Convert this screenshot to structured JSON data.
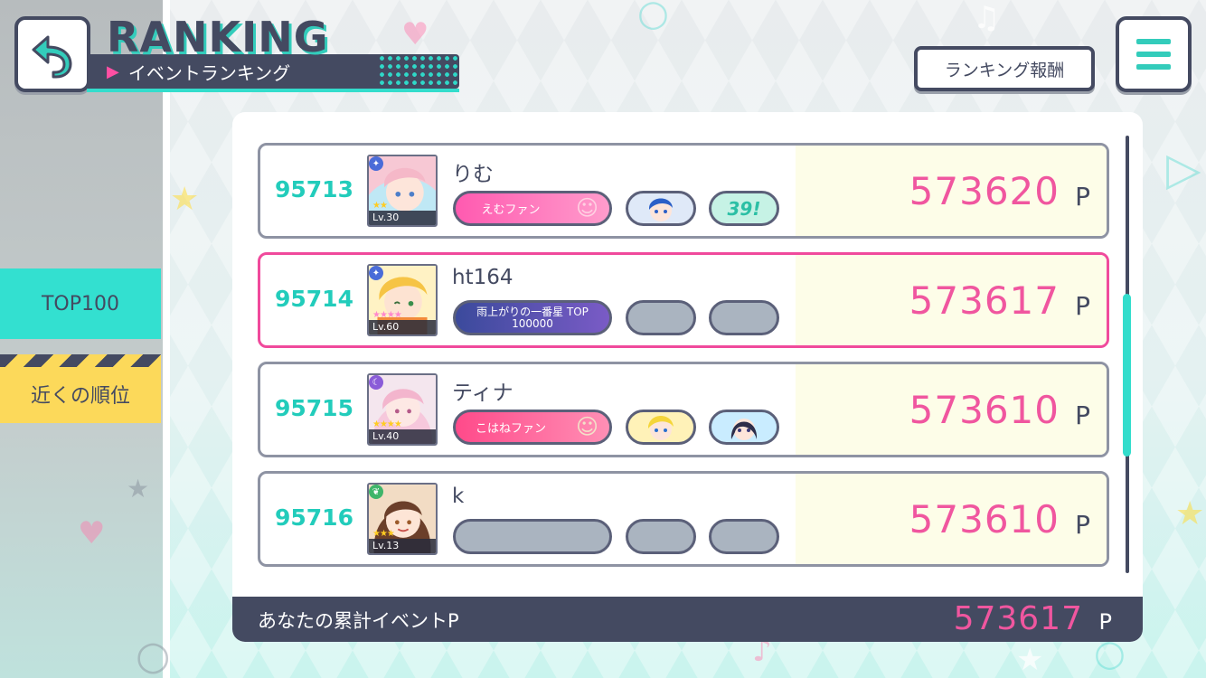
{
  "header": {
    "title": "RANKING",
    "subtitle": "イベントランキング",
    "reward_button": "ランキング報酬"
  },
  "tabs": [
    {
      "label": "TOP100",
      "active": true
    },
    {
      "label": "近くの順位",
      "active": false
    }
  ],
  "rows": [
    {
      "rank": "95713",
      "name": "りむ",
      "level": "Lv.30",
      "score": "573620",
      "unit": "P",
      "highlighted": false,
      "badges": {
        "title": "えむファン",
        "small1": "character-icon",
        "small2": "39!"
      }
    },
    {
      "rank": "95714",
      "name": "ht164",
      "level": "Lv.60",
      "score": "573617",
      "unit": "P",
      "highlighted": true,
      "badges": {
        "title": "雨上がりの一番星 TOP 100000",
        "small1": "",
        "small2": ""
      }
    },
    {
      "rank": "95715",
      "name": "ティナ",
      "level": "Lv.40",
      "score": "573610",
      "unit": "P",
      "highlighted": false,
      "badges": {
        "title": "こはねファン",
        "small1": "character-icon",
        "small2": "character-icon"
      }
    },
    {
      "rank": "95716",
      "name": "k",
      "level": "Lv.13",
      "score": "573610",
      "unit": "P",
      "highlighted": false,
      "badges": {
        "title": "",
        "small1": "",
        "small2": ""
      }
    }
  ],
  "footer": {
    "label": "あなたの累計イベントP",
    "value": "573617",
    "unit": "P"
  },
  "colors": {
    "accent_teal": "#33ddcc",
    "accent_pink": "#f0569f",
    "dark_navy": "#444a61",
    "tab_yellow": "#fcd95a"
  }
}
